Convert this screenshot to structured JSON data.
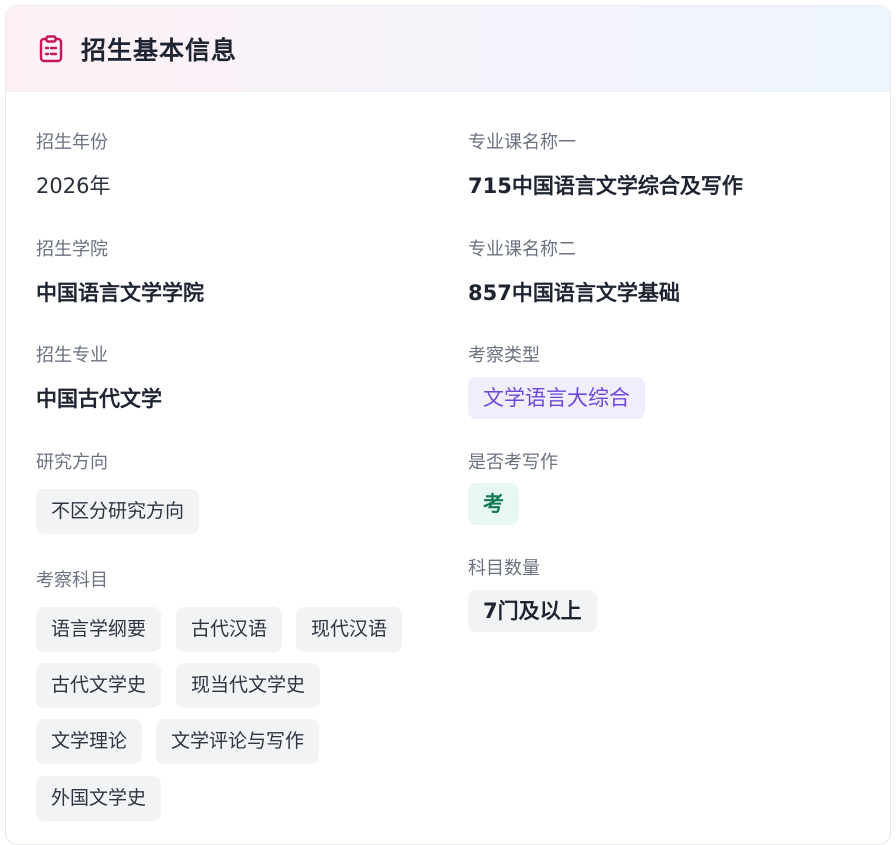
{
  "header": {
    "title": "招生基本信息",
    "icon": "clipboard-list-icon",
    "icon_color": "#c8175b"
  },
  "left": {
    "year": {
      "label": "招生年份",
      "value": "2026年"
    },
    "college": {
      "label": "招生学院",
      "value": "中国语言文学学院"
    },
    "major": {
      "label": "招生专业",
      "value": "中国古代文学"
    },
    "direction": {
      "label": "研究方向",
      "tags": [
        "不区分研究方向"
      ]
    },
    "subjects": {
      "label": "考察科目",
      "tags": [
        "语言学纲要",
        "古代汉语",
        "现代汉语",
        "古代文学史",
        "现当代文学史",
        "文学理论",
        "文学评论与写作",
        "外国文学史"
      ]
    }
  },
  "right": {
    "course1": {
      "label": "专业课名称一",
      "value": "715中国语言文学综合及写作"
    },
    "course2": {
      "label": "专业课名称二",
      "value": "857中国语言文学基础"
    },
    "exam_type": {
      "label": "考察类型",
      "value": "文学语言大综合"
    },
    "writing": {
      "label": "是否考写作",
      "value": "考"
    },
    "subject_count": {
      "label": "科目数量",
      "value": "7门及以上"
    }
  },
  "colors": {
    "purple_tag_bg": "#f1eefc",
    "purple_tag_text": "#6d47d9",
    "green_tag_bg": "#e7f8f1",
    "green_tag_text": "#0f7a55"
  }
}
